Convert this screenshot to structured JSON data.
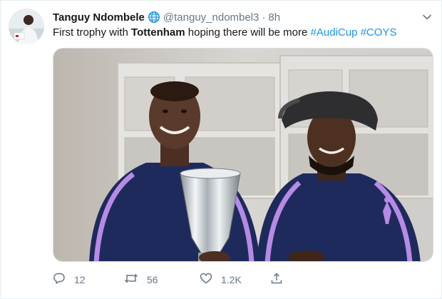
{
  "tweet": {
    "author_name": "Tanguy Ndombele",
    "handle": "@tanguy_ndombel3",
    "separator": "·",
    "time": "8h",
    "text_start": "First trophy with ",
    "text_bold": "Tottenham",
    "text_middle": " hoping there will be more ",
    "hashtag_1": "#AudiCup",
    "hashtag_2": "#COYS"
  },
  "actions": {
    "reply_count": "12",
    "retweet_count": "56",
    "like_count": "1.2K"
  },
  "icons": {
    "verified": "globe-icon",
    "more": "chevron-down-icon",
    "reply": "reply-icon",
    "retweet": "retweet-icon",
    "like": "heart-icon",
    "share": "share-icon"
  },
  "colors": {
    "link": "#1b95e0",
    "secondary_text": "#657786",
    "spurs_navy": "#1f2a5c",
    "spurs_lilac": "#b58be6"
  }
}
